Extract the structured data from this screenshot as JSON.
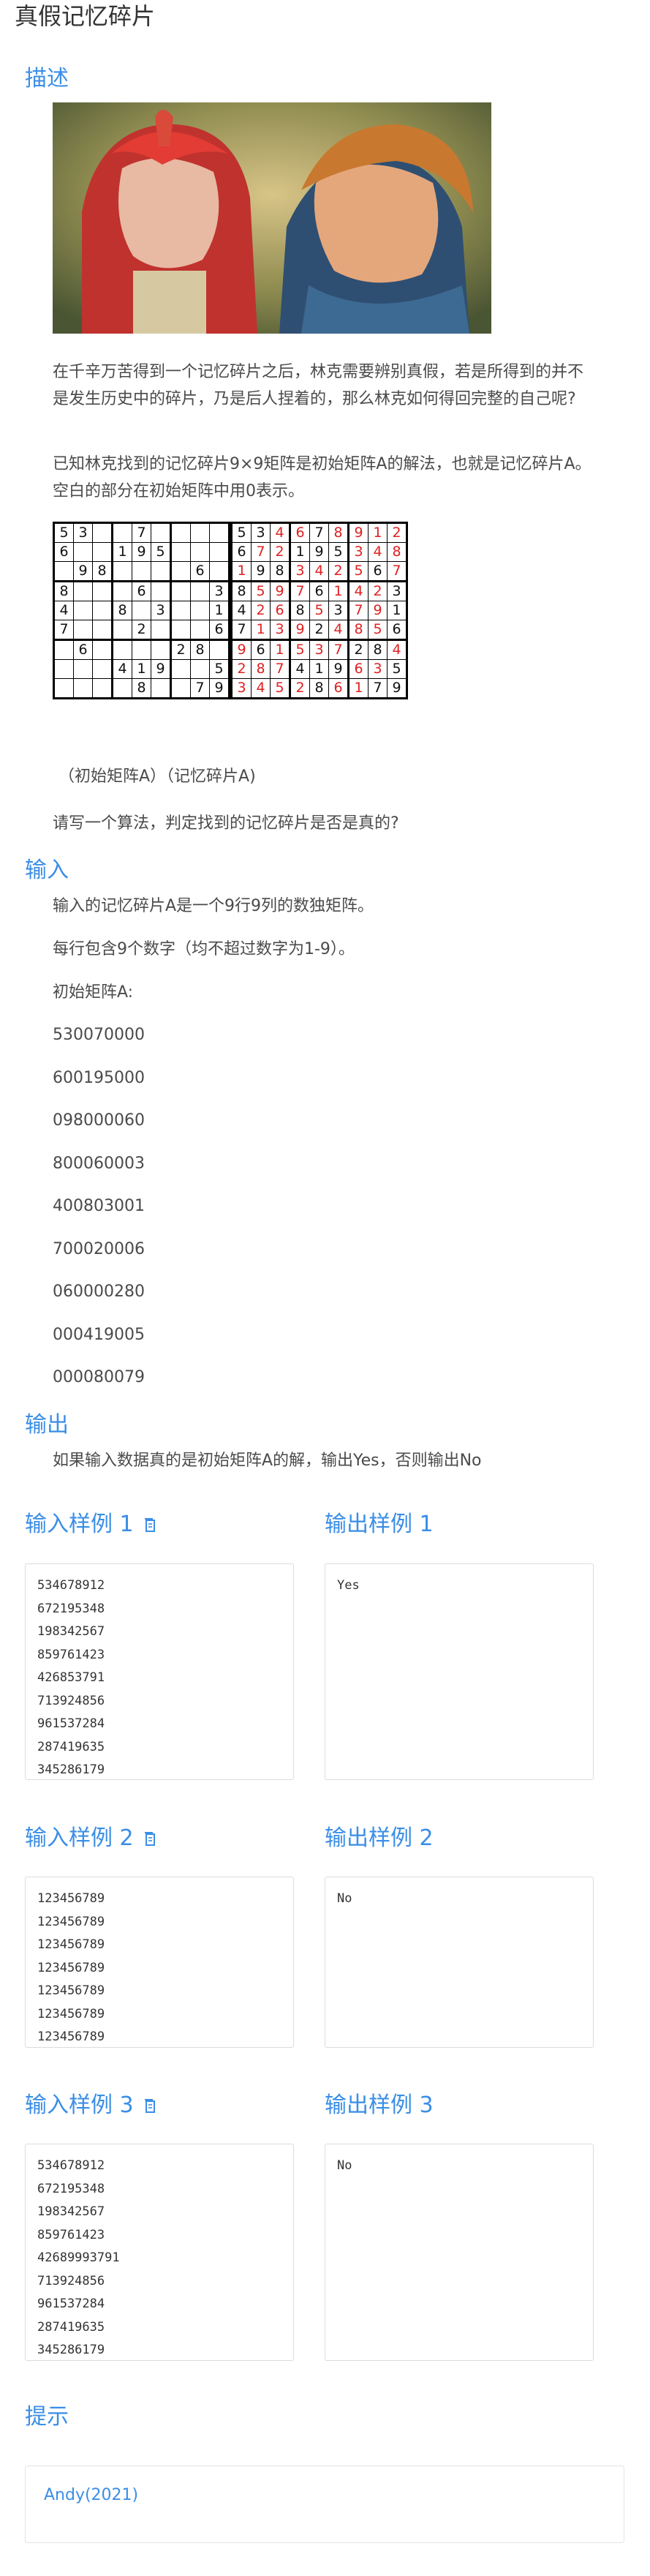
{
  "page": {
    "title": "真假记忆碎片"
  },
  "description": {
    "heading": "描述",
    "para1": "在千辛万苦得到一个记忆碎片之后，林克需要辨别真假，若是所得到的并不是发生历史中的碎片，乃是后人捏着的，那么林克如何得回完整的自己呢?",
    "para2": "已知林克找到的记忆碎片9×9矩阵是初始矩阵A的解法，也就是记忆碎片A。空白的部分在初始矩阵中用0表示。",
    "caption": "（初始矩阵A）（记忆碎片A)",
    "question": "请写一个算法，判定找到的记忆碎片是否是真的?"
  },
  "sudoku": {
    "initial": [
      [
        "5",
        "3",
        "",
        "",
        "7",
        "",
        "",
        "",
        ""
      ],
      [
        "6",
        "",
        "",
        "1",
        "9",
        "5",
        "",
        "",
        ""
      ],
      [
        "",
        "9",
        "8",
        "",
        "",
        "",
        "",
        "6",
        ""
      ],
      [
        "8",
        "",
        "",
        "",
        "6",
        "",
        "",
        "",
        "3"
      ],
      [
        "4",
        "",
        "",
        "8",
        "",
        "3",
        "",
        "",
        "1"
      ],
      [
        "7",
        "",
        "",
        "",
        "2",
        "",
        "",
        "",
        "6"
      ],
      [
        "",
        "6",
        "",
        "",
        "",
        "",
        "2",
        "8",
        ""
      ],
      [
        "",
        "",
        "",
        "4",
        "1",
        "9",
        "",
        "",
        "5"
      ],
      [
        "",
        "",
        "",
        "",
        "8",
        "",
        "",
        "7",
        "9"
      ]
    ],
    "solution": [
      [
        "5",
        "3",
        "4",
        "6",
        "7",
        "8",
        "9",
        "1",
        "2"
      ],
      [
        "6",
        "7",
        "2",
        "1",
        "9",
        "5",
        "3",
        "4",
        "8"
      ],
      [
        "1",
        "9",
        "8",
        "3",
        "4",
        "2",
        "5",
        "6",
        "7"
      ],
      [
        "8",
        "5",
        "9",
        "7",
        "6",
        "1",
        "4",
        "2",
        "3"
      ],
      [
        "4",
        "2",
        "6",
        "8",
        "5",
        "3",
        "7",
        "9",
        "1"
      ],
      [
        "7",
        "1",
        "3",
        "9",
        "2",
        "4",
        "8",
        "5",
        "6"
      ],
      [
        "9",
        "6",
        "1",
        "5",
        "3",
        "7",
        "2",
        "8",
        "4"
      ],
      [
        "2",
        "8",
        "7",
        "4",
        "1",
        "9",
        "6",
        "3",
        "5"
      ],
      [
        "3",
        "4",
        "5",
        "2",
        "8",
        "6",
        "1",
        "7",
        "9"
      ]
    ],
    "given_color": "#111111",
    "filled_color": "#e02020"
  },
  "input": {
    "heading": "输入",
    "line1": "输入的记忆碎片A是一个9行9列的数独矩阵。",
    "line2": "每行包含9个数字（均不超过数字为1-9）。",
    "line3": "初始矩阵A:",
    "matrix": [
      "530070000",
      "600195000",
      "098000060",
      "800060003",
      "400803001",
      "700020006",
      "060000280",
      "000419005",
      "000080079"
    ]
  },
  "output": {
    "heading": "输出",
    "line1": "如果输入数据真的是初始矩阵A的解，输出Yes，否则输出No"
  },
  "samples": [
    {
      "input_title": "输入样例 1",
      "output_title": "输出样例 1",
      "input": [
        "534678912",
        "672195348",
        "198342567",
        "859761423",
        "426853791",
        "713924856",
        "961537284",
        "287419635",
        "345286179"
      ],
      "output": [
        "Yes"
      ]
    },
    {
      "input_title": "输入样例 2",
      "output_title": "输出样例 2",
      "input": [
        "123456789",
        "123456789",
        "123456789",
        "123456789",
        "123456789",
        "123456789",
        "123456789"
      ],
      "output": [
        "No"
      ]
    },
    {
      "input_title": "输入样例 3",
      "output_title": "输出样例 3",
      "input": [
        "534678912",
        "672195348",
        "198342567",
        "859761423",
        "42689993791",
        "713924856",
        "961537284",
        "287419635",
        "345286179"
      ],
      "output": [
        "No"
      ]
    }
  ],
  "hint": {
    "heading": "提示",
    "author": "Andy(2021)"
  },
  "colors": {
    "accent": "#3a8ee6",
    "text": "#4a4a4a"
  },
  "icons": {
    "copy": "copy-icon"
  }
}
